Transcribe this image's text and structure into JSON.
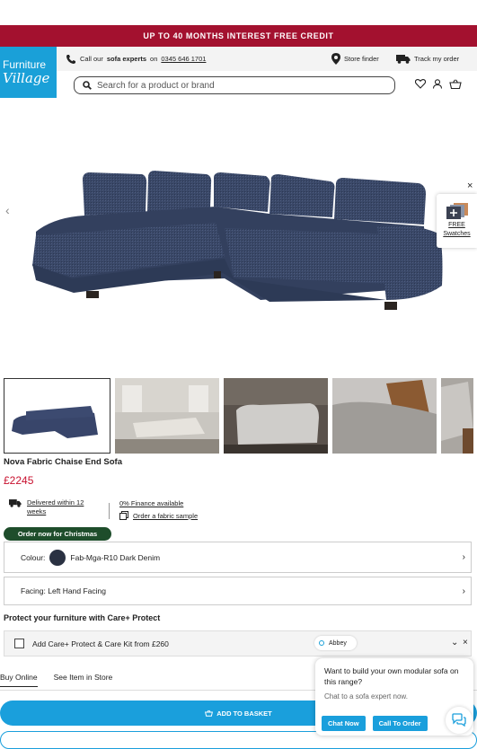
{
  "promo": {
    "text": "UP TO 40 MONTHS INTEREST FREE CREDIT"
  },
  "logo": {
    "line1": "Furniture",
    "line2": "Village"
  },
  "infobar": {
    "call_prefix": "Call our",
    "call_bold": "sofa experts",
    "call_on": "on",
    "phone": "0345 646 1701",
    "store_finder": "Store finder",
    "track_order": "Track my order"
  },
  "search": {
    "placeholder": "Search for a product or brand"
  },
  "gallery": {
    "prev_glyph": "‹",
    "swatch_line1": "FREE",
    "swatch_line2": "Swatches",
    "swatch_close": "×"
  },
  "product": {
    "name": "Nova Fabric Chaise End Sofa",
    "price": "£2245",
    "delivery": "Delivered within 12 weeks",
    "finance": "0% Finance available",
    "fabric_sample": "Order a fabric sample",
    "badge": "Order now for Christmas"
  },
  "options": {
    "colour_label": "Colour:",
    "colour_value": "Fab-Mga-R10 Dark Denim",
    "facing": "Facing: Left Hand Facing",
    "chevron": "›"
  },
  "protect": {
    "title": "Protect your furniture with Care+ Protect",
    "row": "Add Care+ Protect & Care Kit from £260",
    "abbey": "Abbey",
    "chevron": "⌄",
    "close": "×"
  },
  "tabs": [
    "Buy Online",
    "See Item in Store"
  ],
  "basket": {
    "label": "ADD TO BASKET"
  },
  "chat": {
    "question": "Want to build your own modular sofa on this range?",
    "sub": "Chat to a sofa expert now.",
    "btn_chat": "Chat Now",
    "btn_call": "Call To Order"
  },
  "colors": {
    "accent": "#1a9fdc",
    "promo": "#a3112f",
    "price": "#c8102e",
    "badge": "#1e4d2b"
  }
}
